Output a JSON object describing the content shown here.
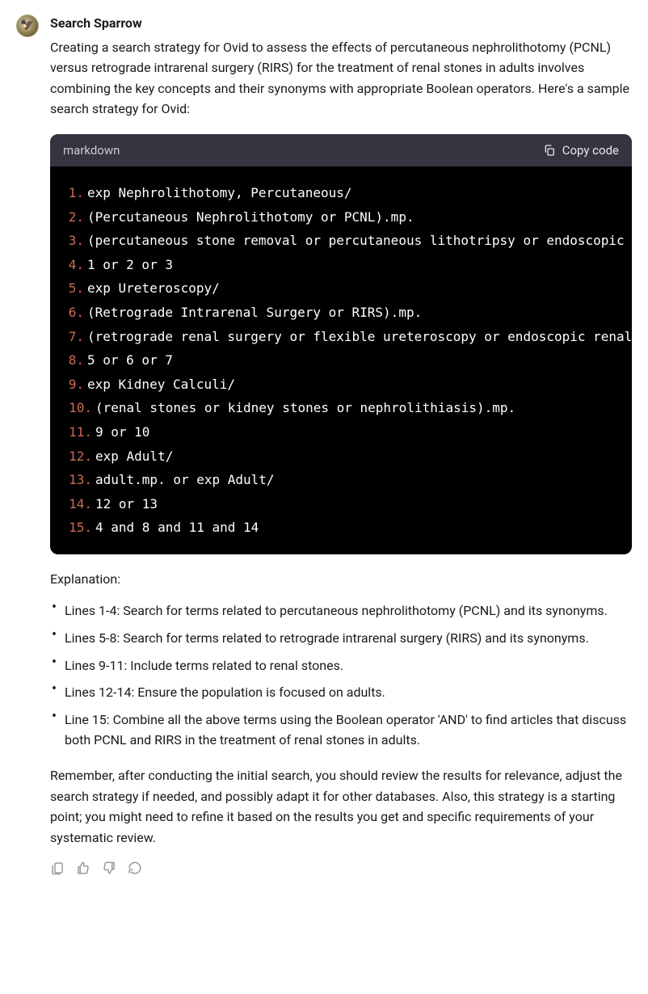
{
  "author": "Search Sparrow",
  "intro": "Creating a search strategy for Ovid to assess the effects of percutaneous nephrolithotomy (PCNL) versus retrograde intrarenal surgery (RIRS) for the treatment of renal stones in adults involves combining the key concepts and their synonyms with appropriate Boolean operators. Here's a sample search strategy for Ovid:",
  "code": {
    "language": "markdown",
    "copy_label": "Copy code",
    "lines": [
      {
        "n": "1.",
        "text": "exp Nephrolithotomy, Percutaneous/"
      },
      {
        "n": "2.",
        "text": "(Percutaneous Nephrolithotomy or PCNL).mp."
      },
      {
        "n": "3.",
        "text": "(percutaneous stone removal or percutaneous lithotripsy or endoscopic nephrolithotomy).mp."
      },
      {
        "n": "4.",
        "text": "1 or 2 or 3"
      },
      {
        "n": "5.",
        "text": "exp Ureteroscopy/"
      },
      {
        "n": "6.",
        "text": "(Retrograde Intrarenal Surgery or RIRS).mp."
      },
      {
        "n": "7.",
        "text": "(retrograde renal surgery or flexible ureteroscopy or endoscopic renal surgery).mp."
      },
      {
        "n": "8.",
        "text": "5 or 6 or 7"
      },
      {
        "n": "9.",
        "text": "exp Kidney Calculi/"
      },
      {
        "n": "10.",
        "text": "(renal stones or kidney stones or nephrolithiasis).mp."
      },
      {
        "n": "11.",
        "text": "9 or 10"
      },
      {
        "n": "12.",
        "text": "exp Adult/"
      },
      {
        "n": "13.",
        "text": "adult.mp. or exp Adult/"
      },
      {
        "n": "14.",
        "text": "12 or 13"
      },
      {
        "n": "15.",
        "text": "4 and 8 and 11 and 14"
      }
    ]
  },
  "explanation_label": "Explanation:",
  "bullets": [
    "Lines 1-4: Search for terms related to percutaneous nephrolithotomy (PCNL) and its synonyms.",
    "Lines 5-8: Search for terms related to retrograde intrarenal surgery (RIRS) and its synonyms.",
    "Lines 9-11: Include terms related to renal stones.",
    "Lines 12-14: Ensure the population is focused on adults.",
    "Line 15: Combine all the above terms using the Boolean operator 'AND' to find articles that discuss both PCNL and RIRS in the treatment of renal stones in adults."
  ],
  "closing": "Remember, after conducting the initial search, you should review the results for relevance, adjust the search strategy if needed, and possibly adapt it for other databases. Also, this strategy is a starting point; you might need to refine it based on the results you get and specific requirements of your systematic review."
}
